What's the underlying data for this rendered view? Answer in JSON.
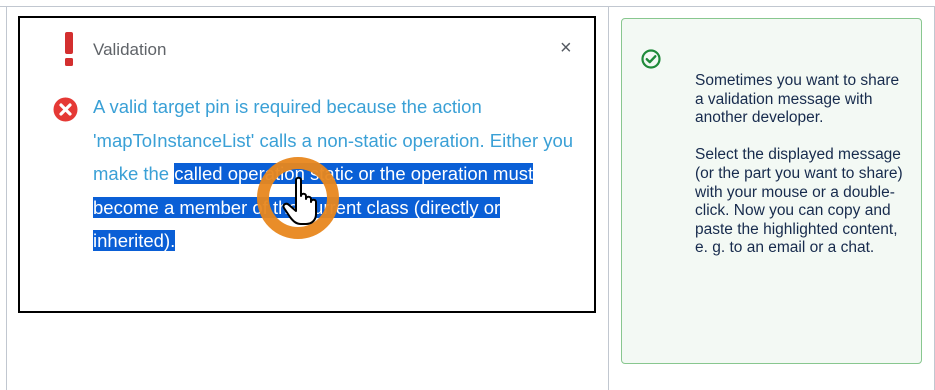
{
  "dialog": {
    "title": "Validation",
    "close_symbol": "×",
    "message_plain": "A valid target pin is required because the action 'mapToInstanceList' calls a non-static operation. Either you make the ",
    "message_selected": "called operation static or the operation must become a member of the current class (directly or inherited).",
    "icons": {
      "title": "exclamation-icon",
      "message": "error-x-icon",
      "close": "close-icon",
      "cursor": "hand-pointer-icon"
    },
    "colors": {
      "message_text": "#3aa0d6",
      "selection": "#0a5fd6",
      "error": "#e53935",
      "exclamation": "#d32f2f",
      "cursor_ring": "#e8871e"
    }
  },
  "tip": {
    "icon": "check-circle-icon",
    "paragraph_1": "Sometimes you want to share a validation message with another developer.",
    "paragraph_2": "Select the displayed message (or the part you want to share) with your mouse or a double-click. Now you can copy and paste the highlighted content, e. g. to an email or a chat.",
    "colors": {
      "background": "#f3f9f4",
      "border": "#88c78f",
      "icon": "#1f8a3a"
    }
  }
}
